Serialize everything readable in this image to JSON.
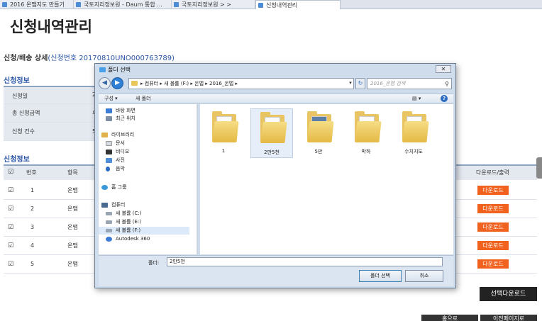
{
  "browser": {
    "tabs": [
      "2016 온맵지도 만들기",
      "국토지리정보원 - Daum 통합 ...",
      "국토지리정보원 > >",
      "신청내역관리"
    ]
  },
  "page": {
    "title": "신청내역관리",
    "detail_title": "신청/배송 상세",
    "request_no": "(신청번호 20170810UNO000763789)",
    "section_info": "신청정보",
    "section_list": "신청정보",
    "info_rows": [
      {
        "label": "신청일",
        "value": "2"
      },
      {
        "label": "총 신청금액",
        "value": "무"
      },
      {
        "label": "신청 건수",
        "value": "5"
      }
    ],
    "list_headers": {
      "no": "번호",
      "item": "항목",
      "download": "다운로드/출력"
    },
    "list_rows": [
      {
        "no": "1",
        "item": "온맵",
        "btn": "다운로드"
      },
      {
        "no": "2",
        "item": "온맵",
        "btn": "다운로드"
      },
      {
        "no": "3",
        "item": "온맵",
        "btn": "다운로드"
      },
      {
        "no": "4",
        "item": "온맵",
        "btn": "다운로드"
      },
      {
        "no": "5",
        "item": "온맵",
        "btn": "다운로드"
      }
    ],
    "check_mark": "☑",
    "selected_download": "선택다운로드",
    "bottom_buttons": [
      "홈으로",
      "이전페이지로"
    ]
  },
  "dialog": {
    "title": "폴더 선택",
    "close_label": "✕",
    "address": [
      "컴퓨터",
      "새 볼륨 (F:)",
      "온맵",
      "2016_온맵"
    ],
    "search_placeholder": "2016_온맵 검색",
    "search_glyph": "⚲",
    "organize": "구성 ▾",
    "new_folder": "새 폴더",
    "view_glyph": "▤ ▾",
    "help_glyph": "?",
    "tree": [
      {
        "label": "바탕 화면",
        "color": "#3a7bd5"
      },
      {
        "label": "최근 위치",
        "color": "#7d8ea5"
      },
      {
        "label": "라이브러리",
        "color": "#e0b34a"
      },
      {
        "label": "문서",
        "color": "#d4d9e2"
      },
      {
        "label": "비디오",
        "color": "#333333"
      },
      {
        "label": "사진",
        "color": "#4d8fd6"
      },
      {
        "label": "음악",
        "color": "#2a6ac0"
      },
      {
        "label": "홈 그룹",
        "color": "#3a9ad9"
      },
      {
        "label": "컴퓨터",
        "color": "#4a6b8f"
      },
      {
        "label": "새 볼륨 (C:)",
        "color": "#9aa5b3"
      },
      {
        "label": "새 볼륨 (E:)",
        "color": "#9aa5b3"
      },
      {
        "label": "새 볼륨 (F:)",
        "color": "#9aa5b3"
      },
      {
        "label": "Autodesk 360",
        "color": "#3a7bd5"
      }
    ],
    "folders": [
      "1",
      "2만5천",
      "5만",
      "박하",
      "수치지도"
    ],
    "folder_label": "폴더:",
    "folder_value": "2만5천",
    "ok": "폴더 선택",
    "cancel": "취소"
  }
}
